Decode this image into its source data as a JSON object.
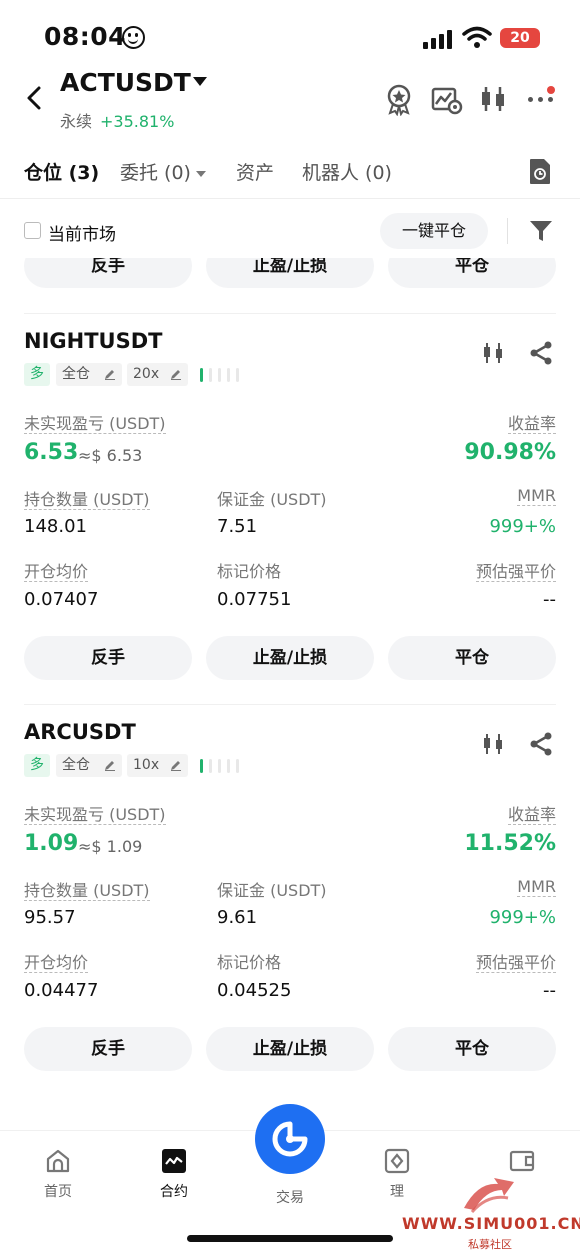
{
  "status_bar": {
    "time": "08:04",
    "battery": "20",
    "emoji": "smiling-face-icon"
  },
  "header": {
    "symbol": "ACTUSDT",
    "type": "永续",
    "change": "+35.81%",
    "icons": [
      "medal-icon",
      "chart-gear-icon",
      "candlestick-icon",
      "more-icon"
    ]
  },
  "tabs": [
    {
      "label": "仓位 (3)",
      "active": true
    },
    {
      "label": "委托 (0)",
      "dropdown": true
    },
    {
      "label": "资产"
    },
    {
      "label": "机器人 (0)"
    }
  ],
  "filter": {
    "current_market_label": "当前市场",
    "close_all_label": "一键平仓"
  },
  "actions": {
    "reverse": "反手",
    "tpsl": "止盈/止损",
    "close": "平仓"
  },
  "labels": {
    "unrealized_pnl": "未实现盈亏 (USDT)",
    "roi": "收益率",
    "position_size": "持仓数量 (USDT)",
    "margin": "保证金 (USDT)",
    "mmr": "MMR",
    "entry_price": "开仓均价",
    "mark_price": "标记价格",
    "liq_price": "预估强平价"
  },
  "positions": [
    {
      "symbol": "NIGHTUSDT",
      "side": "多",
      "margin_mode": "全仓",
      "leverage": "20x",
      "risk_level": 1,
      "pnl": "6.53",
      "pnl_approx": "≈$ 6.53",
      "roi": "90.98%",
      "size": "148.01",
      "margin": "7.51",
      "mmr": "999+%",
      "entry_price": "0.07407",
      "mark_price": "0.07751",
      "liq_price": "--"
    },
    {
      "symbol": "ARCUSDT",
      "side": "多",
      "margin_mode": "全仓",
      "leverage": "10x",
      "risk_level": 1,
      "pnl": "1.09",
      "pnl_approx": "≈$ 1.09",
      "roi": "11.52%",
      "size": "95.57",
      "margin": "9.61",
      "mmr": "999+%",
      "entry_price": "0.04477",
      "mark_price": "0.04525",
      "liq_price": "--"
    }
  ],
  "bottom_nav": [
    {
      "label": "首页",
      "icon": "home-icon"
    },
    {
      "label": "合约",
      "icon": "futures-icon",
      "active": true
    },
    {
      "label": "交易",
      "icon": "trade-icon"
    },
    {
      "label": "理",
      "icon": "finance-icon"
    },
    {
      "label": "",
      "icon": "wallet-icon"
    }
  ],
  "watermark": {
    "text": "WWW.SIMU001.CN",
    "sub": "私募社区"
  },
  "colors": {
    "green": "#20b26c",
    "blue": "#1e6ff2",
    "red": "#e5463f"
  }
}
